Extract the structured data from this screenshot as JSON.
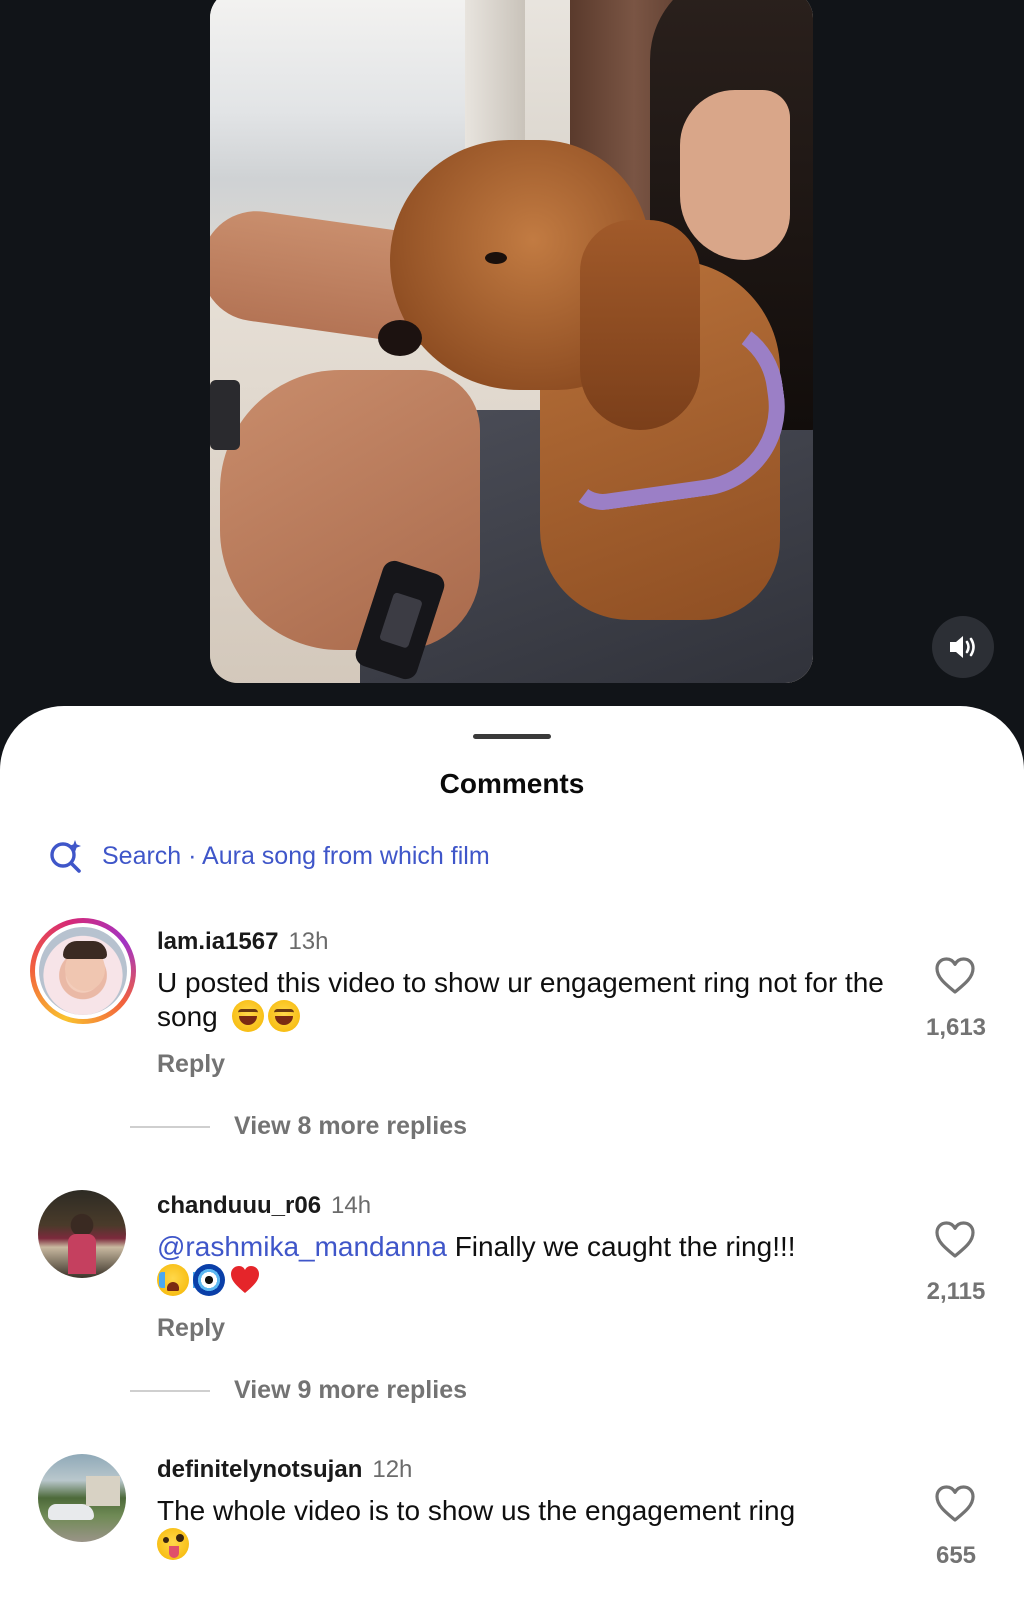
{
  "sheet": {
    "title": "Comments",
    "search": {
      "text": "Search · Aura song from which film"
    }
  },
  "video": {
    "sound_icon": "speaker-volume-icon"
  },
  "comments": [
    {
      "username": "lam.ia1567",
      "time": "13h",
      "text": "U posted this video to show ur engagement ring not for the song",
      "emojis": [
        "face-with-tears-of-joy",
        "face-with-tears-of-joy"
      ],
      "reply_label": "Reply",
      "likes": "1,613",
      "view_replies": "View 8 more replies"
    },
    {
      "username": "chanduuu_r06",
      "time": "14h",
      "mention": "@rashmika_mandanna",
      "text": "Finally we caught the ring!!!",
      "emojis": [
        "loudly-crying-face",
        "nazar-amulet",
        "red-heart"
      ],
      "reply_label": "Reply",
      "likes": "2,115",
      "view_replies": "View 9 more replies"
    },
    {
      "username": "definitelynotsujan",
      "time": "12h",
      "text": "The whole video is to show us the engagement ring",
      "emojis": [
        "zany-face"
      ],
      "likes": "655"
    }
  ],
  "colors": {
    "link_blue": "#3f56c9",
    "muted_gray": "#737373",
    "background_dark": "#111418"
  }
}
